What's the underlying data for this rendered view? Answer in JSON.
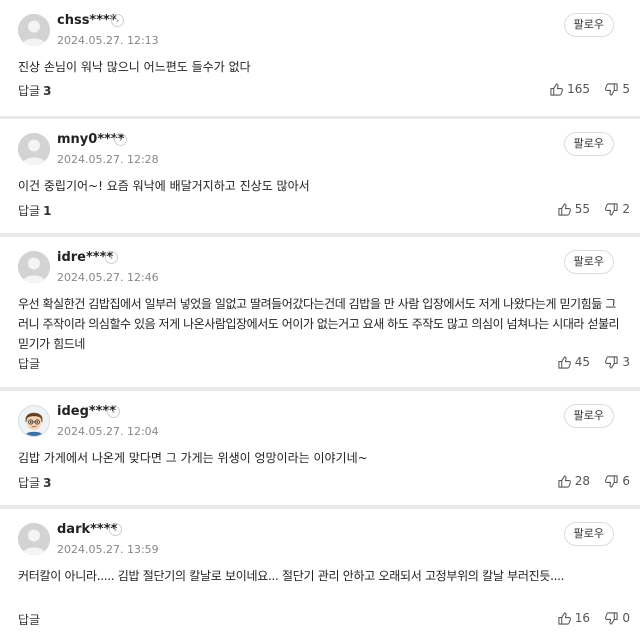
{
  "follow_label": "팔로우",
  "replies_label": "답글",
  "comments": [
    {
      "user": "chss****",
      "date": "2024.05.27. 12:13",
      "text": "진상 손님이 워낙 많으니 어느편도 들수가 없다",
      "replies": "3",
      "likes": "165",
      "dislikes": "5",
      "avatar": "default-avatar"
    },
    {
      "user": "mny0****",
      "date": "2024.05.27. 12:28",
      "text": "이건 중립기어~! 요즘 워낙에 배달거지하고 진상도 많아서",
      "replies": "1",
      "likes": "55",
      "dislikes": "2",
      "avatar": "default-avatar"
    },
    {
      "user": "idre****",
      "date": "2024.05.27. 12:46",
      "text": "우선 확실한건 김밥집에서 일부러 넣었을 일없고 딸려들어갔다는건데 김밥을 만 사람 입장에서도 저게 나왔다는게 믿기힘듦 그러니 주작이라 의심할수 있음 저게 나온사람입장에서도 어이가 없는거고 요새 하도 주작도 많고 의심이 넘쳐나는 시대라 섣불리 믿기가 힘드네",
      "replies": "",
      "likes": "45",
      "dislikes": "3",
      "avatar": "default-avatar"
    },
    {
      "user": "ideg****",
      "date": "2024.05.27. 12:04",
      "text": "김밥 가게에서 나온게 맞다면 그 가게는 위생이 엉망이라는 이야기네~",
      "replies": "3",
      "likes": "28",
      "dislikes": "6",
      "avatar": "character-avatar"
    },
    {
      "user": "dark****",
      "date": "2024.05.27. 13:59",
      "text": "커터칼이 아니라..... 김밥 절단기의 칼날로 보이네요... 절단기 관리 안하고 오래되서 고정부위의 칼날 부러진듯....",
      "replies": "",
      "likes": "16",
      "dislikes": "0",
      "avatar": "default-avatar"
    }
  ]
}
